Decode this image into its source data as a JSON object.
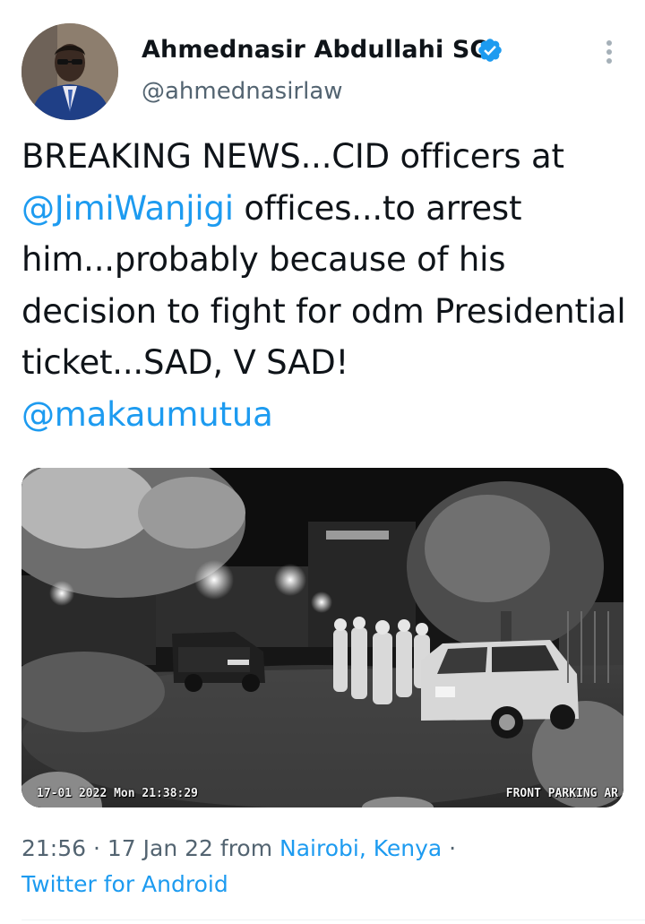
{
  "author": {
    "display_name": "Ahmednasir Abdullahi SC",
    "handle": "@ahmednasirlaw",
    "verified": true
  },
  "tweet": {
    "text_before_mention": "BREAKING NEWS...CID officers at ",
    "mention_1": "@JimiWanjigi",
    "text_after_mention": " offices...to arrest him...probably because of his decision to fight for odm Presidential ticket...SAD, V SAD!",
    "mention_2": "@makaumutua"
  },
  "media": {
    "timestamp_overlay": "17-01 2022 Mon 21:38:29",
    "camera_label": "FRONT PARKING AR"
  },
  "meta": {
    "time": "21:56",
    "separator": " · ",
    "date": "17 Jan 22",
    "from_text": " from ",
    "location": "Nairobi, Kenya",
    "separator_2": " ·",
    "source": "Twitter for Android"
  },
  "colors": {
    "link": "#1d9bf0",
    "secondary_text": "#536471",
    "primary_text": "#0f1419"
  },
  "icons": [
    "verified-badge-icon",
    "more-options-icon"
  ]
}
